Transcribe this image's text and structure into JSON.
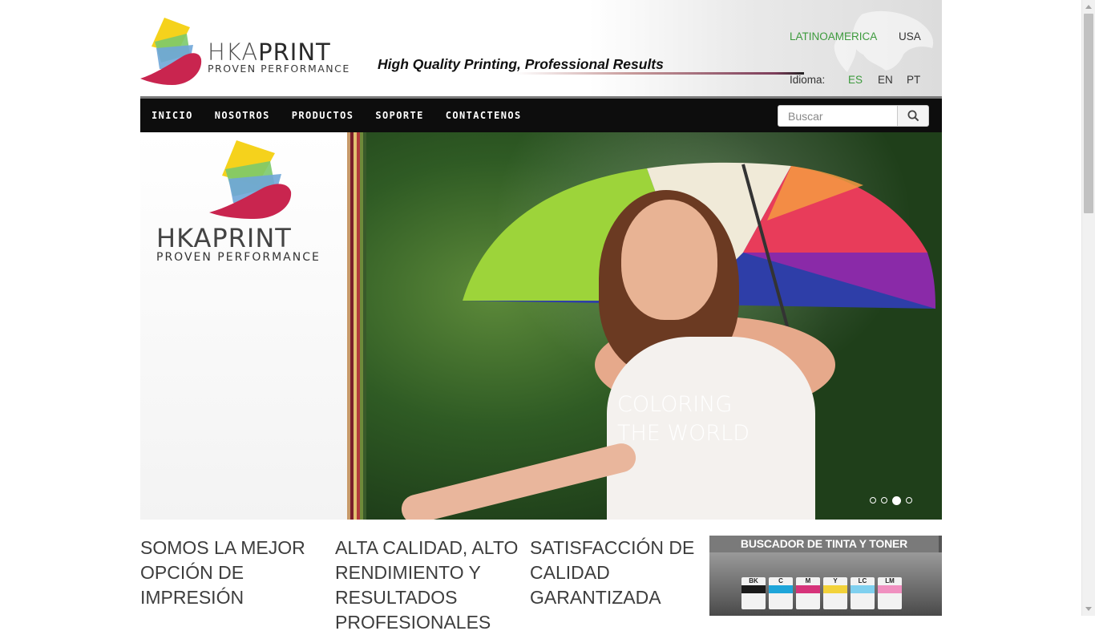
{
  "header": {
    "brand_word": "HKA",
    "brand_word_bold": "PRINT",
    "brand_tagline": "PROVEN PERFORMANCE",
    "slogan": "High Quality Printing, Professional Results",
    "regions": [
      "LATINOAMERICA",
      "USA"
    ],
    "language_label": "Idioma:",
    "languages": [
      "ES",
      "EN",
      "PT"
    ],
    "active_color": "#3c9a3c"
  },
  "nav": {
    "items": [
      "INICIO",
      "NOSOTROS",
      "PRODUCTOS",
      "SOPORTE",
      "CONTACTENOS"
    ],
    "search_placeholder": "Buscar",
    "search_icon": "search-icon"
  },
  "hero": {
    "logo_word": "HKAPRINT",
    "logo_tagline": "PROVEN PERFORMANCE",
    "caption_line1": "COLORING",
    "caption_line2": "THE WORLD",
    "slide_count": 4,
    "active_slide": 3
  },
  "features": [
    "SOMOS LA MEJOR OPCIÓN DE IMPRESIÓN",
    "ALTA CALIDAD, ALTO RENDIMIENTO Y RESULTADOS PROFESIONALES",
    "SATISFACCIÓN DE CALIDAD GARANTIZADA"
  ],
  "ink_finder": {
    "title": "BUSCADOR DE TINTA Y TONER",
    "cartridges": [
      {
        "code": "BK",
        "color": "#1a1a1a"
      },
      {
        "code": "C",
        "color": "#1ea5d9"
      },
      {
        "code": "M",
        "color": "#d6337a"
      },
      {
        "code": "Y",
        "color": "#f2d23a"
      },
      {
        "code": "LC",
        "color": "#7fd0ef"
      },
      {
        "code": "LM",
        "color": "#f090c0"
      }
    ]
  }
}
